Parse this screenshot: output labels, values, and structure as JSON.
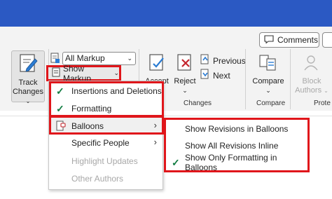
{
  "ribbon": {
    "comments_label": "Comments",
    "track_changes_label_1": "Track",
    "track_changes_label_2": "Changes",
    "markup_select_value": "All Markup",
    "show_markup_label": "Show Markup",
    "accept_label": "Accept",
    "reject_label": "Reject",
    "previous_label": "Previous",
    "next_label": "Next",
    "compare_label": "Compare",
    "block_authors_label_1": "Block",
    "block_authors_label_2": "Authors",
    "groups": {
      "changes": "Changes",
      "compare": "Compare",
      "protect": "Prote"
    }
  },
  "show_markup_menu": {
    "items": [
      {
        "label": "Insertions and Deletions",
        "checked": true
      },
      {
        "label": "Formatting",
        "checked": true
      },
      {
        "label": "Balloons",
        "submenu": true
      },
      {
        "label": "Specific People",
        "submenu": true
      },
      {
        "label": "Highlight Updates",
        "disabled": true
      },
      {
        "label": "Other Authors",
        "disabled": true
      }
    ]
  },
  "balloons_submenu": {
    "items": [
      {
        "label": "Show Revisions in Balloons",
        "checked": false
      },
      {
        "label": "Show All Revisions Inline",
        "checked": false
      },
      {
        "label": "Show Only Formatting in Balloons",
        "checked": true
      }
    ]
  },
  "colors": {
    "titlebar": "#2b59c3",
    "highlight_border": "#e0161b",
    "check": "#107c41"
  }
}
